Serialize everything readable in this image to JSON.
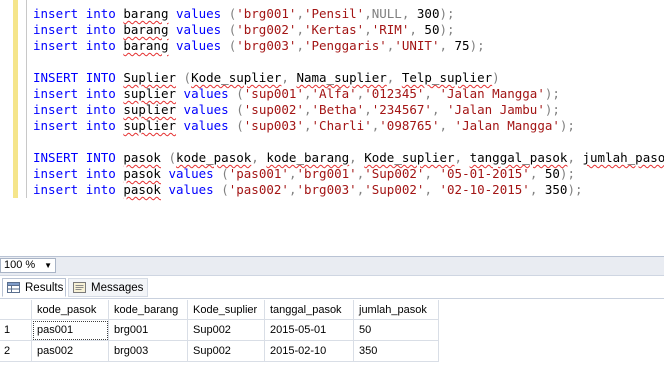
{
  "editor": {
    "lines": [
      [
        [
          "kw",
          "insert"
        ],
        [
          "t",
          " "
        ],
        [
          "kw",
          "into"
        ],
        [
          "t",
          " "
        ],
        [
          "sq",
          "barang"
        ],
        [
          "t",
          " "
        ],
        [
          "kw",
          "values"
        ],
        [
          "t",
          " "
        ],
        [
          "op",
          "("
        ],
        [
          "str",
          "'brg001'"
        ],
        [
          "op",
          ","
        ],
        [
          "str",
          "'Pensil'"
        ],
        [
          "op",
          ","
        ],
        [
          "nul",
          "NULL"
        ],
        [
          "op",
          ","
        ],
        [
          "t",
          " 300"
        ],
        [
          "op",
          ");"
        ]
      ],
      [
        [
          "kw",
          "insert"
        ],
        [
          "t",
          " "
        ],
        [
          "kw",
          "into"
        ],
        [
          "t",
          " "
        ],
        [
          "sq",
          "barang"
        ],
        [
          "t",
          " "
        ],
        [
          "kw",
          "values"
        ],
        [
          "t",
          " "
        ],
        [
          "op",
          "("
        ],
        [
          "str",
          "'brg002'"
        ],
        [
          "op",
          ","
        ],
        [
          "str",
          "'Kertas'"
        ],
        [
          "op",
          ","
        ],
        [
          "str",
          "'RIM'"
        ],
        [
          "op",
          ","
        ],
        [
          "t",
          " 50"
        ],
        [
          "op",
          ");"
        ]
      ],
      [
        [
          "kw",
          "insert"
        ],
        [
          "t",
          " "
        ],
        [
          "kw",
          "into"
        ],
        [
          "t",
          " "
        ],
        [
          "sq",
          "barang"
        ],
        [
          "t",
          " "
        ],
        [
          "kw",
          "values"
        ],
        [
          "t",
          " "
        ],
        [
          "op",
          "("
        ],
        [
          "str",
          "'brg003'"
        ],
        [
          "op",
          ","
        ],
        [
          "str",
          "'Penggaris'"
        ],
        [
          "op",
          ","
        ],
        [
          "str",
          "'UNIT'"
        ],
        [
          "op",
          ","
        ],
        [
          "t",
          " 75"
        ],
        [
          "op",
          ");"
        ]
      ],
      [],
      [
        [
          "kw",
          "INSERT"
        ],
        [
          "t",
          " "
        ],
        [
          "kw",
          "INTO"
        ],
        [
          "t",
          " "
        ],
        [
          "sq",
          "Suplier"
        ],
        [
          "t",
          " "
        ],
        [
          "op",
          "("
        ],
        [
          "sq",
          "Kode_suplier"
        ],
        [
          "op",
          ","
        ],
        [
          "t",
          " "
        ],
        [
          "sq",
          "Nama_suplier"
        ],
        [
          "op",
          ","
        ],
        [
          "t",
          " "
        ],
        [
          "sq",
          "Telp_suplier"
        ],
        [
          "op",
          ")"
        ]
      ],
      [
        [
          "kw",
          "insert"
        ],
        [
          "t",
          " "
        ],
        [
          "kw",
          "into"
        ],
        [
          "t",
          " "
        ],
        [
          "sq",
          "suplier"
        ],
        [
          "t",
          " "
        ],
        [
          "kw",
          "values"
        ],
        [
          "t",
          " "
        ],
        [
          "op",
          "("
        ],
        [
          "str",
          "'sup001'"
        ],
        [
          "op",
          ","
        ],
        [
          "str",
          "'Alfa'"
        ],
        [
          "op",
          ","
        ],
        [
          "str",
          "'012345'"
        ],
        [
          "op",
          ","
        ],
        [
          "t",
          " "
        ],
        [
          "str",
          "'Jalan Mangga'"
        ],
        [
          "op",
          ");"
        ]
      ],
      [
        [
          "kw",
          "insert"
        ],
        [
          "t",
          " "
        ],
        [
          "kw",
          "into"
        ],
        [
          "t",
          " "
        ],
        [
          "sq",
          "suplier"
        ],
        [
          "t",
          " "
        ],
        [
          "kw",
          "values"
        ],
        [
          "t",
          " "
        ],
        [
          "op",
          "("
        ],
        [
          "str",
          "'sup002'"
        ],
        [
          "op",
          ","
        ],
        [
          "str",
          "'Betha'"
        ],
        [
          "op",
          ","
        ],
        [
          "str",
          "'234567'"
        ],
        [
          "op",
          ","
        ],
        [
          "t",
          " "
        ],
        [
          "str",
          "'Jalan Jambu'"
        ],
        [
          "op",
          ");"
        ]
      ],
      [
        [
          "kw",
          "insert"
        ],
        [
          "t",
          " "
        ],
        [
          "kw",
          "into"
        ],
        [
          "t",
          " "
        ],
        [
          "sq",
          "suplier"
        ],
        [
          "t",
          " "
        ],
        [
          "kw",
          "values"
        ],
        [
          "t",
          " "
        ],
        [
          "op",
          "("
        ],
        [
          "str",
          "'sup003'"
        ],
        [
          "op",
          ","
        ],
        [
          "str",
          "'Charli'"
        ],
        [
          "op",
          ","
        ],
        [
          "str",
          "'098765'"
        ],
        [
          "op",
          ","
        ],
        [
          "t",
          " "
        ],
        [
          "str",
          "'Jalan Mangga'"
        ],
        [
          "op",
          ");"
        ]
      ],
      [],
      [
        [
          "kw",
          "INSERT"
        ],
        [
          "t",
          " "
        ],
        [
          "kw",
          "INTO"
        ],
        [
          "t",
          " "
        ],
        [
          "sq",
          "pasok"
        ],
        [
          "t",
          " "
        ],
        [
          "op",
          "("
        ],
        [
          "sq",
          "kode_pasok"
        ],
        [
          "op",
          ","
        ],
        [
          "t",
          " "
        ],
        [
          "sq",
          "kode_barang"
        ],
        [
          "op",
          ","
        ],
        [
          "t",
          " "
        ],
        [
          "sq",
          "Kode_suplier"
        ],
        [
          "op",
          ","
        ],
        [
          "t",
          " "
        ],
        [
          "sq",
          "tanggal_pasok"
        ],
        [
          "op",
          ","
        ],
        [
          "t",
          " "
        ],
        [
          "sq",
          "jumlah_pasok"
        ],
        [
          "op",
          ")"
        ]
      ],
      [
        [
          "kw",
          "insert"
        ],
        [
          "t",
          " "
        ],
        [
          "kw",
          "into"
        ],
        [
          "t",
          " "
        ],
        [
          "sq",
          "pasok"
        ],
        [
          "t",
          " "
        ],
        [
          "kw",
          "values"
        ],
        [
          "t",
          " "
        ],
        [
          "op",
          "("
        ],
        [
          "str",
          "'pas001'"
        ],
        [
          "op",
          ","
        ],
        [
          "str",
          "'brg001'"
        ],
        [
          "op",
          ","
        ],
        [
          "str",
          "'Sup002'"
        ],
        [
          "op",
          ","
        ],
        [
          "t",
          " "
        ],
        [
          "str",
          "'05-01-2015'"
        ],
        [
          "op",
          ","
        ],
        [
          "t",
          " 50"
        ],
        [
          "op",
          ");"
        ]
      ],
      [
        [
          "kw",
          "insert"
        ],
        [
          "t",
          " "
        ],
        [
          "kw",
          "into"
        ],
        [
          "t",
          " "
        ],
        [
          "sq",
          "pasok"
        ],
        [
          "t",
          " "
        ],
        [
          "kw",
          "values"
        ],
        [
          "t",
          " "
        ],
        [
          "op",
          "("
        ],
        [
          "str",
          "'pas002'"
        ],
        [
          "op",
          ","
        ],
        [
          "str",
          "'brg003'"
        ],
        [
          "op",
          ","
        ],
        [
          "str",
          "'Sup002'"
        ],
        [
          "op",
          ","
        ],
        [
          "t",
          " "
        ],
        [
          "str",
          "'02-10-2015'"
        ],
        [
          "op",
          ","
        ],
        [
          "t",
          " 350"
        ],
        [
          "op",
          ");"
        ]
      ]
    ]
  },
  "zoom": {
    "value": "100 %"
  },
  "tabs": {
    "results": "Results",
    "messages": "Messages"
  },
  "grid": {
    "columns": [
      "kode_pasok",
      "kode_barang",
      "Kode_suplier",
      "tanggal_pasok",
      "jumlah_pasok"
    ],
    "rows": [
      {
        "num": "1",
        "cells": [
          "pas001",
          "brg001",
          "Sup002",
          "2015-05-01",
          "50"
        ]
      },
      {
        "num": "2",
        "cells": [
          "pas002",
          "brg003",
          "Sup002",
          "2015-02-10",
          "350"
        ]
      }
    ]
  },
  "colors": {
    "keyword": "#0000ff",
    "string": "#a31515",
    "operator": "#808080",
    "error_squiggle": "#e53030"
  }
}
